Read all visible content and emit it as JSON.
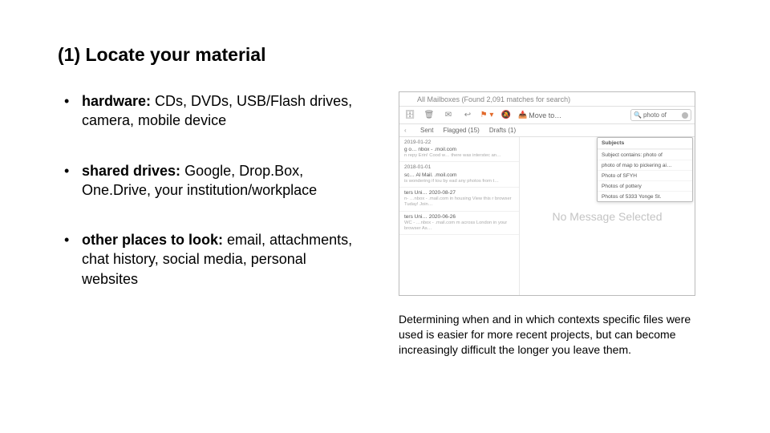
{
  "title": "(1) Locate your material",
  "bullets": [
    {
      "label": "hardware:",
      "text": "  CDs, DVDs, USB/Flash drives, camera, mobile device"
    },
    {
      "label": "shared drives:",
      "text": "  Google, Drop.Box, One.Drive, your institution/workplace"
    },
    {
      "label": "other places to look:",
      "text": " email, attachments, chat history, social media, personal websites"
    }
  ],
  "mail": {
    "top": "All Mailboxes (Found 2,091 matches for search)",
    "moveTo": "Move to…",
    "searchValue": "photo of",
    "tabs": {
      "sent": "Sent",
      "flagged": "Flagged (15)",
      "drafts": "Drafts (1)"
    },
    "list": [
      {
        "date": "2019-01-22",
        "from": "g o…    nbox - .moil.com",
        "prev": "n repy Erin! Cood w…\nthere was interstec an…"
      },
      {
        "date": "2018-01-01",
        "from": "sc…  Al Mail. .moil.com",
        "prev": "is wondering if tou by\nead any photos from t…"
      },
      {
        "date": "",
        "from": "ters Uni…  2020-08-27",
        "prev": "n- …nbox - .mail.com\nin housing View this\nr browser Tuday! Join…"
      },
      {
        "date": "",
        "from": "ters Uni…  2020-06-26",
        "prev": "WC - …nbox - .mail.com\nm across London\nin your browser As…"
      }
    ],
    "dropdown": {
      "head": "Subjects",
      "items": [
        "Subject contains: photo of",
        "photo of map to pickering ai…",
        "Photo of SFYH",
        "Photos of pottery",
        "Photos of 5333 Yonge St."
      ]
    },
    "noMessage": "No Message Selected"
  },
  "caption": "Determining when and in which contexts specific files were used is easier for more recent projects, but can become increasingly difficult the longer you leave them."
}
